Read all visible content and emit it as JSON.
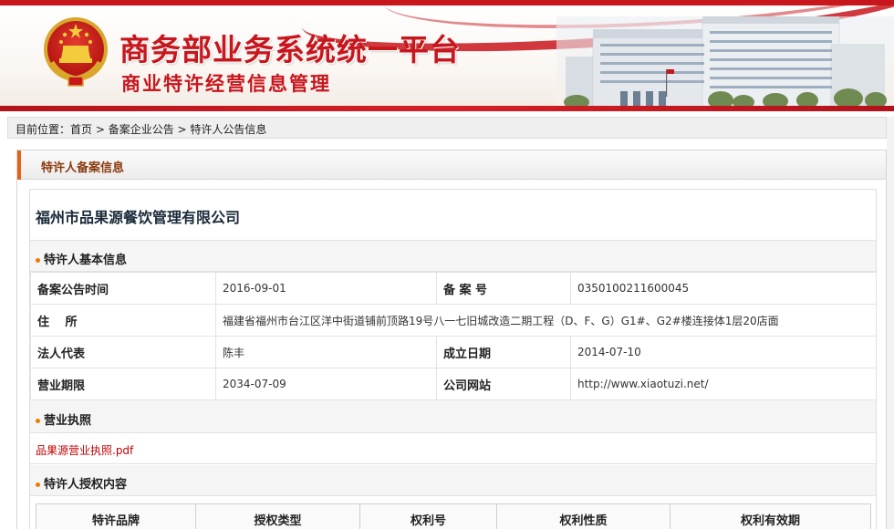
{
  "header": {
    "title": "商务部业务系统统一平台",
    "subtitle": "商业特许经营信息管理",
    "emblem_icon": "national-emblem-icon",
    "building_image": "ministry-building-image",
    "accent_color": "#c8161d"
  },
  "breadcrumb": {
    "prefix": "目前位置：",
    "items": [
      "首页",
      "备案企业公告",
      "特许人公告信息"
    ],
    "separator": " > "
  },
  "panel": {
    "title": "特许人备案信息",
    "accent_color": "#e0641c"
  },
  "company": {
    "name": "福州市品果源餐饮管理有限公司"
  },
  "basic_info": {
    "section_title": "特许人基本信息",
    "rows": [
      {
        "label1": "备案公告时间",
        "value1": "2016-09-01",
        "label2": "备 案 号",
        "value2": "0350100211600045"
      },
      {
        "label1": "住　 所",
        "value1": "福建省福州市台江区洋中街道铺前顶路19号八一七旧城改造二期工程（D、F、G）G1#、G2#楼连接体1层20店面"
      },
      {
        "label1": "法人代表",
        "value1": "陈丰",
        "label2": "成立日期",
        "value2": "2014-07-10"
      },
      {
        "label1": "营业期限",
        "value1": "2034-07-09",
        "label2": "公司网站",
        "value2": "http://www.xiaotuzi.net/"
      }
    ]
  },
  "license": {
    "section_title": "营业执照",
    "file_link": "品果源营业执照.pdf"
  },
  "authorization": {
    "section_title": "特许人授权内容",
    "columns": [
      "特许品牌",
      "授权类型",
      "权利号",
      "权利性质",
      "权利有效期"
    ]
  }
}
